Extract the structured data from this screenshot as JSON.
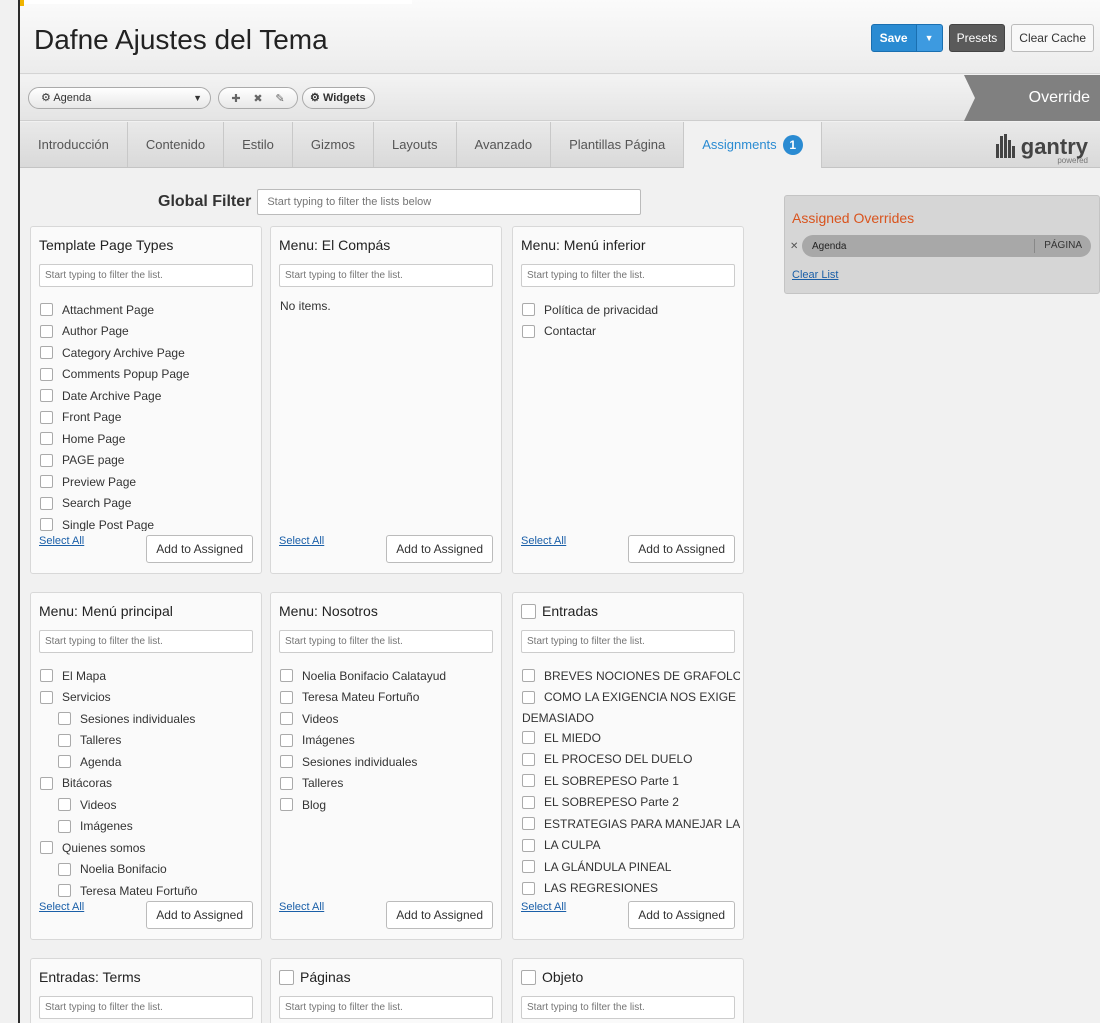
{
  "header": {
    "title": "Dafne Ajustes del Tema",
    "save_label": "Save",
    "presets_label": "Presets",
    "clear_cache_label": "Clear Cache"
  },
  "toolbar": {
    "selected_override": "Agenda",
    "widgets_label": "Widgets",
    "override_label": "Override"
  },
  "tabs": [
    {
      "label": "Introducción"
    },
    {
      "label": "Contenido"
    },
    {
      "label": "Estilo"
    },
    {
      "label": "Gizmos"
    },
    {
      "label": "Layouts"
    },
    {
      "label": "Avanzado"
    },
    {
      "label": "Plantillas Página"
    },
    {
      "label": "Assignments",
      "badge": "1"
    }
  ],
  "brand": {
    "name": "gantry",
    "sub": "powered"
  },
  "global_filter": {
    "label": "Global Filter",
    "placeholder": "Start typing to filter the lists below"
  },
  "common": {
    "list_placeholder": "Start typing to filter the list.",
    "select_all": "Select All",
    "add_to_assigned": "Add to Assigned",
    "no_items": "No items."
  },
  "panels": {
    "template_page_types": {
      "title": "Template Page Types",
      "items": [
        "Attachment Page",
        "Author Page",
        "Category Archive Page",
        "Comments Popup Page",
        "Date Archive Page",
        "Front Page",
        "Home Page",
        "PAGE page",
        "Preview Page",
        "Search Page",
        "Single Post Page"
      ]
    },
    "menu_el_compas": {
      "title": "Menu: El Compás"
    },
    "menu_inferior": {
      "title": "Menu: Menú inferior",
      "items": [
        "Política de privacidad",
        "Contactar"
      ]
    },
    "menu_principal": {
      "title": "Menu: Menú principal",
      "items": [
        "El Mapa",
        "Servicios",
        "Sesiones individuales",
        "Talleres",
        "Agenda",
        "Bitácoras",
        "Videos",
        "Imágenes",
        "Quienes somos",
        "Noelia Bonifacio",
        "Teresa Mateu Fortuño"
      ]
    },
    "menu_nosotros": {
      "title": "Menu: Nosotros",
      "items": [
        "Noelia Bonifacio Calatayud",
        "Teresa Mateu Fortuño",
        "Videos",
        "Imágenes",
        "Sesiones individuales",
        "Talleres",
        "Blog"
      ]
    },
    "entradas": {
      "title": "Entradas",
      "items": [
        "BREVES NOCIONES DE GRAFOLOGÍA",
        "COMO LA EXIGENCIA NOS EXIGE",
        "DEMASIADO",
        "EL MIEDO",
        "EL PROCESO DEL DUELO",
        "EL SOBREPESO Parte 1",
        "EL SOBREPESO Parte 2",
        "ESTRATEGIAS PARA MANEJAR LA IRA",
        "LA CULPA",
        "LA GLÁNDULA PINEAL",
        "LAS REGRESIONES"
      ]
    },
    "entradas_terms": {
      "title": "Entradas: Terms"
    },
    "paginas": {
      "title": "Páginas"
    },
    "objeto": {
      "title": "Objeto"
    }
  },
  "assigned": {
    "title": "Assigned Overrides",
    "item_name": "Agenda",
    "item_type": "PÁGINA",
    "clear_list": "Clear List"
  },
  "colors": {
    "accent": "#2a8bd2",
    "override_title": "#d9541e"
  }
}
